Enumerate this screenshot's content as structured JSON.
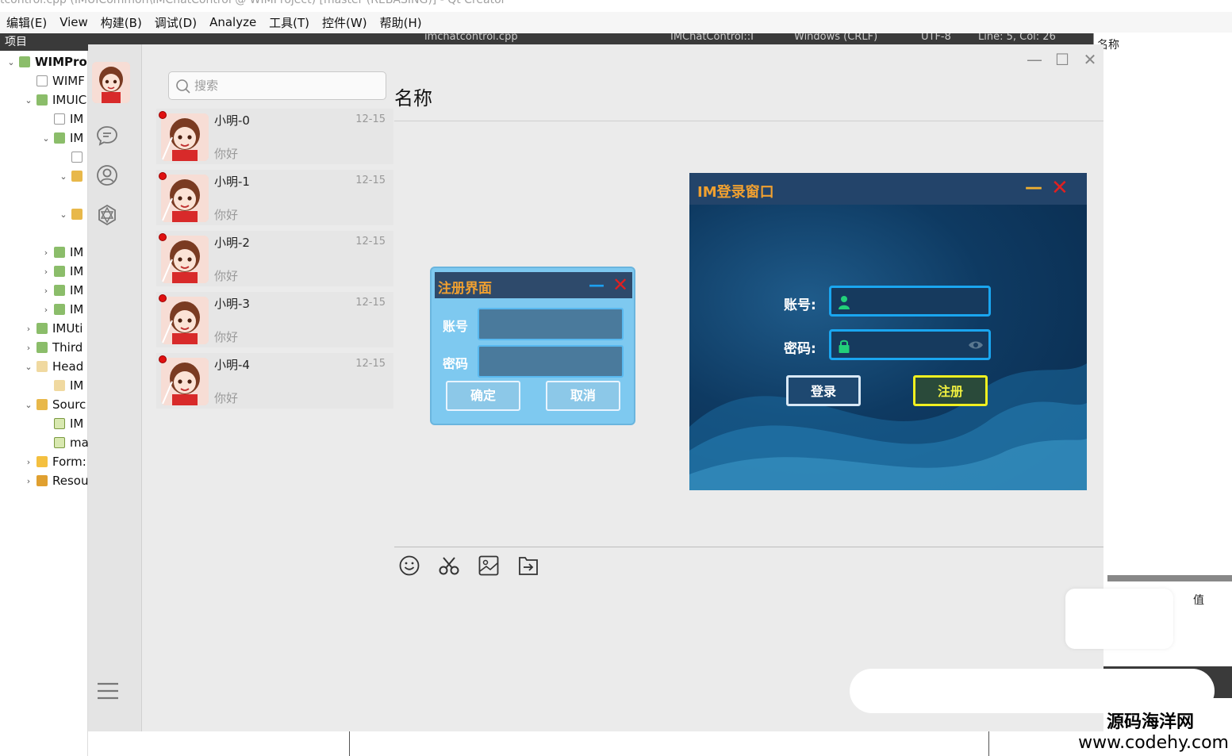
{
  "qt": {
    "title": "tcontrol.cpp (IMUICommon\\IMChatControl @ WIMProject) [master (REBASING)] - Qt Creator",
    "menu": [
      "编辑(E)",
      "View",
      "构建(B)",
      "调试(D)",
      "Analyze",
      "工具(T)",
      "控件(W)",
      "帮助(H)"
    ],
    "project_label": "项目",
    "editor_file": "imchatcontrol.cpp",
    "editor_class": "IMChatControl::I",
    "editor_encoding": "Windows (CRLF)",
    "editor_utf": "UTF-8",
    "editor_pos": "Line: 5, Col: 26",
    "right_header": "名称",
    "value_header": "值",
    "tree": [
      {
        "label": "WIMPro",
        "arrow": "down",
        "icon": "pro",
        "bold": true
      },
      {
        "label": "WIMF",
        "arrow": "",
        "icon": "file"
      },
      {
        "label": "IMUIC",
        "arrow": "down",
        "icon": "pro"
      },
      {
        "label": "IM",
        "arrow": "",
        "icon": "file"
      },
      {
        "label": "IM",
        "arrow": "down",
        "icon": "pro"
      },
      {
        "label": "",
        "arrow": "",
        "icon": "file"
      },
      {
        "label": "",
        "arrow": "down",
        "icon": "folder"
      },
      {
        "label": "",
        "arrow": "down",
        "icon": "folder"
      },
      {
        "label": "IM",
        "arrow": "right",
        "icon": "pro"
      },
      {
        "label": "IM",
        "arrow": "right",
        "icon": "pro"
      },
      {
        "label": "IM",
        "arrow": "right",
        "icon": "pro"
      },
      {
        "label": "IM",
        "arrow": "right",
        "icon": "pro"
      },
      {
        "label": "IMUti",
        "arrow": "right",
        "icon": "pro"
      },
      {
        "label": "Third",
        "arrow": "right",
        "icon": "pro"
      },
      {
        "label": "Head",
        "arrow": "down",
        "icon": "head"
      },
      {
        "label": "IM",
        "arrow": "",
        "icon": "head"
      },
      {
        "label": "Sourc",
        "arrow": "down",
        "icon": "folder"
      },
      {
        "label": "IM",
        "arrow": "",
        "icon": "src"
      },
      {
        "label": "ma",
        "arrow": "",
        "icon": "src"
      },
      {
        "label": "Form:",
        "arrow": "right",
        "icon": "form"
      },
      {
        "label": "Resou",
        "arrow": "right",
        "icon": "res"
      }
    ]
  },
  "chat": {
    "search_placeholder": "搜索",
    "header_title": "名称",
    "contacts": [
      {
        "name": "小明-0",
        "time": "12-15",
        "message": "你好"
      },
      {
        "name": "小明-1",
        "time": "12-15",
        "message": "你好"
      },
      {
        "name": "小明-2",
        "time": "12-15",
        "message": "你好"
      },
      {
        "name": "小明-3",
        "time": "12-15",
        "message": "你好"
      },
      {
        "name": "小明-4",
        "time": "12-15",
        "message": "你好"
      }
    ],
    "nav_icons": [
      "chat-bubble-icon",
      "contact-person-icon",
      "settings-gear-icon",
      "menu-icon"
    ],
    "tools": [
      "emoji-icon",
      "scissors-icon",
      "image-icon",
      "file-send-icon"
    ]
  },
  "register": {
    "title": "注册界面",
    "account_label": "账号",
    "password_label": "密码",
    "confirm": "确定",
    "cancel": "取消"
  },
  "login": {
    "title": "IM登录窗口",
    "account_label": "账号:",
    "password_label": "密码:",
    "signin": "登录",
    "signup": "注册"
  },
  "watermark": {
    "line1": "源码海洋网",
    "line2": "www.codehy.com"
  },
  "colors": {
    "accent_orange": "#f0a030",
    "login_border": "#1aa6f0",
    "signup_yellow": "#f0f020",
    "close_red": "#e02020",
    "unread_dot": "#e01010"
  }
}
